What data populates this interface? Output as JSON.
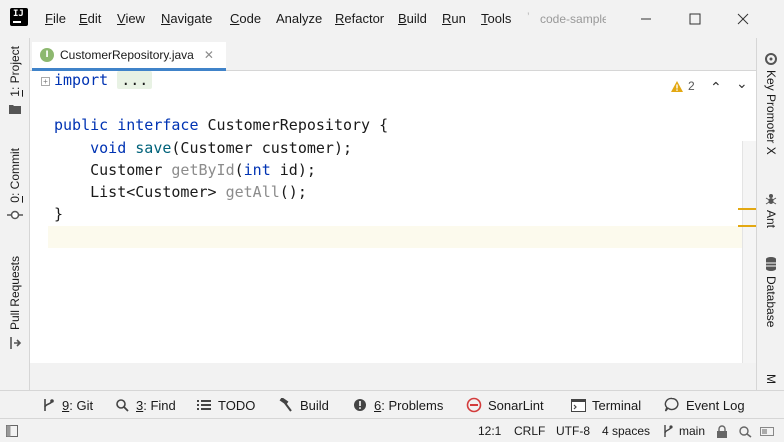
{
  "menu": {
    "items": [
      {
        "label": "File",
        "mnemonic": "F",
        "rest": "ile"
      },
      {
        "label": "Edit",
        "mnemonic": "E",
        "rest": "dit"
      },
      {
        "label": "View",
        "mnemonic": "V",
        "rest": "iew"
      },
      {
        "label": "Navigate",
        "mnemonic": "N",
        "rest": "avigate"
      },
      {
        "label": "Code",
        "mnemonic": "C",
        "rest": "ode"
      },
      {
        "label": "Analyze",
        "mnemonic": "",
        "rest": "Analyze"
      },
      {
        "label": "Refactor",
        "mnemonic": "R",
        "rest": "efactor"
      },
      {
        "label": "Build",
        "mnemonic": "B",
        "rest": "uild"
      },
      {
        "label": "Run",
        "mnemonic": "R",
        "rest": "un"
      },
      {
        "label": "Tools",
        "mnemonic": "T",
        "rest": "ools"
      }
    ],
    "project_name": "code-sample"
  },
  "left_strip": {
    "project": {
      "num": "1",
      "label": ": Project"
    },
    "commit": {
      "num": "0",
      "label": ": Commit"
    },
    "pull_requests": {
      "label": "Pull Requests"
    }
  },
  "right_strip": {
    "key_promoter": "Key Promoter X",
    "ant": "Ant",
    "database": "Database",
    "partial": "M"
  },
  "editor": {
    "tab_label": "CustomerRepository.java",
    "tab_icon_letter": "I",
    "warning_count": "2",
    "code": {
      "import_kw": "import",
      "folded": "...",
      "decl_kw1": "public",
      "decl_kw2": "interface",
      "decl_name": "CustomerRepository {",
      "m1_kw": "void",
      "m1_name": "save",
      "m1_rest": "(Customer customer);",
      "m2_type": "Customer ",
      "m2_name": "getById",
      "m2_paren": "(",
      "m2_kw": "int",
      "m2_rest": " id);",
      "m3_type": "List<Customer> ",
      "m3_name": "getAll",
      "m3_rest": "();",
      "close": "}"
    }
  },
  "tool_windows": [
    {
      "num": "9",
      "label": ": Git",
      "icon": "git-branch-icon"
    },
    {
      "num": "3",
      "label": ": Find",
      "icon": "search-icon"
    },
    {
      "num": "",
      "label": "TODO",
      "icon": "list-icon"
    },
    {
      "num": "",
      "label": "Build",
      "icon": "hammer-icon"
    },
    {
      "num": "6",
      "label": ": Problems",
      "icon": "info-icon"
    },
    {
      "num": "",
      "label": "SonarLint",
      "icon": "sonarlint-icon"
    },
    {
      "num": "",
      "label": "Terminal",
      "icon": "terminal-icon"
    },
    {
      "num": "",
      "label": "Event Log",
      "icon": "event-log-icon"
    }
  ],
  "status": {
    "position": "12:1",
    "line_sep": "CRLF",
    "encoding": "UTF-8",
    "indent": "4 spaces",
    "branch": "main"
  },
  "colors": {
    "accent": "#4083c9",
    "warning": "#e3a812",
    "keyword": "#0033b3"
  }
}
